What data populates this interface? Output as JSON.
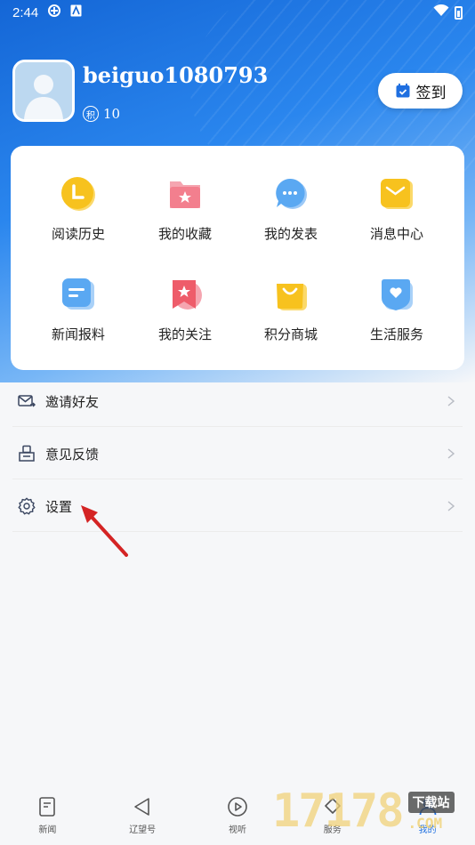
{
  "status_bar": {
    "time": "2:44"
  },
  "profile": {
    "username": "beiguo1080793",
    "points_badge": "积",
    "points": "10",
    "checkin_label": "签到"
  },
  "grid": [
    {
      "label": "阅读历史",
      "icon": "reading-history-icon",
      "color": "#f7c21e"
    },
    {
      "label": "我的收藏",
      "icon": "favorites-folder-icon",
      "color": "#f37f8e"
    },
    {
      "label": "我的发表",
      "icon": "chat-bubble-icon",
      "color": "#5aa8f2"
    },
    {
      "label": "消息中心",
      "icon": "envelope-icon",
      "color": "#f7c21e"
    },
    {
      "label": "新闻报料",
      "icon": "news-report-icon",
      "color": "#5aa8f2"
    },
    {
      "label": "我的关注",
      "icon": "follow-bookmark-icon",
      "color": "#ee5c6a"
    },
    {
      "label": "积分商城",
      "icon": "shopping-bag-icon",
      "color": "#f7c21e"
    },
    {
      "label": "生活服务",
      "icon": "heart-shield-icon",
      "color": "#5aa8f2"
    }
  ],
  "menu": [
    {
      "label": "邀请好友",
      "icon": "invite-mail-icon"
    },
    {
      "label": "意见反馈",
      "icon": "feedback-icon"
    },
    {
      "label": "设置",
      "icon": "gear-icon"
    }
  ],
  "tabbar": [
    {
      "label": "新闻",
      "icon": "news-icon"
    },
    {
      "label": "辽望号",
      "icon": "triangle-icon"
    },
    {
      "label": "视听",
      "icon": "play-icon"
    },
    {
      "label": "服务",
      "icon": "service-icon"
    },
    {
      "label": "我的",
      "icon": "profile-icon"
    }
  ],
  "watermark": {
    "digits": "17178",
    "top": "下载站",
    "bottom": ".COM"
  },
  "colors": {
    "primary": "#1466d6",
    "accent_yellow": "#f7c21e",
    "accent_red": "#e03030"
  }
}
